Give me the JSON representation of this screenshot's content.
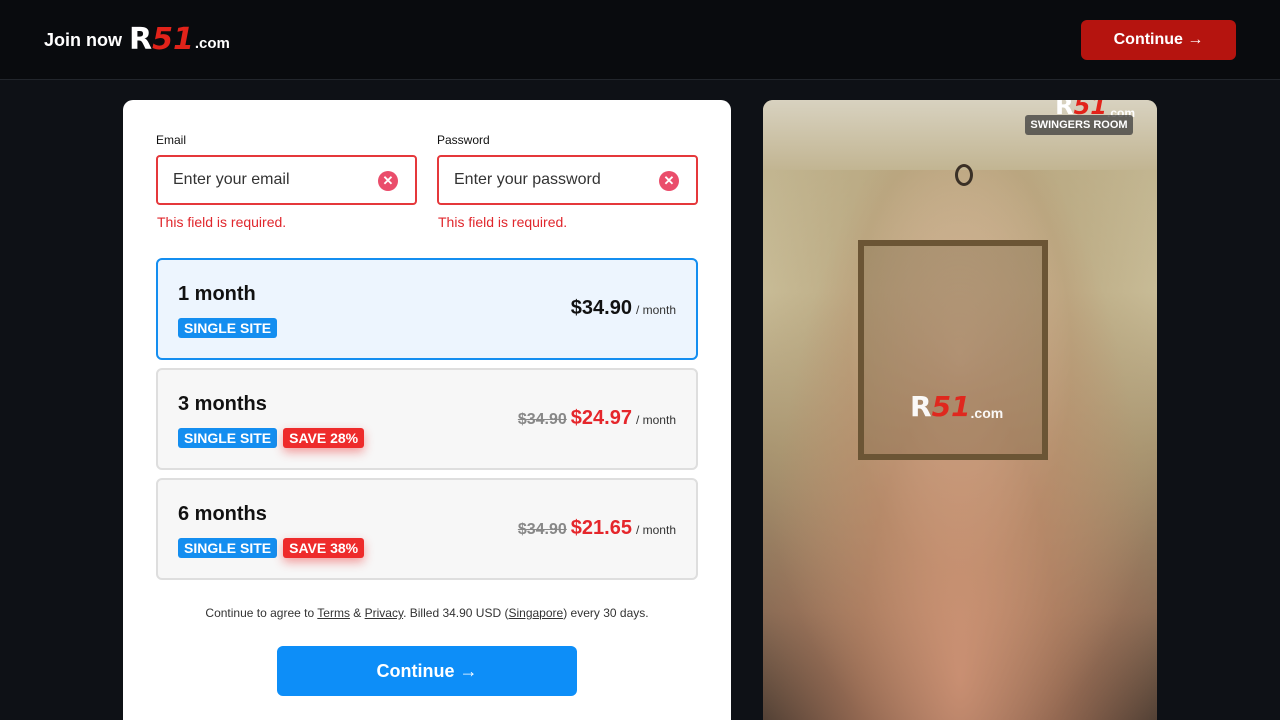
{
  "header": {
    "join_label": "Join now",
    "logo": {
      "r": "R",
      "num": "51",
      "dotcom": ".com"
    },
    "cta_label": "Continue →"
  },
  "form": {
    "email": {
      "label": "Email",
      "placeholder": "Enter your email",
      "value": "",
      "error": "This field is required."
    },
    "password": {
      "label": "Password",
      "placeholder": "Enter your password",
      "value": "",
      "error": "This field is required."
    }
  },
  "plans": [
    {
      "title": "1 month",
      "tags": [
        "SINGLE SITE"
      ],
      "old_price": "",
      "price": "$34.90",
      "per": "/ month",
      "selected": true
    },
    {
      "title": "3 months",
      "tags": [
        "SINGLE SITE",
        "SAVE 28%"
      ],
      "old_price": "$34.90",
      "price": "$24.97",
      "per": "/ month",
      "selected": false
    },
    {
      "title": "6 months",
      "tags": [
        "SINGLE SITE",
        "SAVE 38%"
      ],
      "old_price": "$34.90",
      "price": "$21.65",
      "per": "/ month",
      "selected": false
    }
  ],
  "fine_print": {
    "prefix": "Continue to agree to ",
    "terms": "Terms",
    "amp": " & ",
    "privacy": "Privacy",
    "middle": ". Billed 34.90 USD (",
    "country": "Singapore",
    "suffix": ") every 30 days."
  },
  "cta_label": "Continue →",
  "promo": {
    "room_badge": "SWINGERS ROOM",
    "watermark": {
      "r": "R",
      "num": "51",
      "dotcom": ".com"
    }
  },
  "colors": {
    "accent_blue": "#0d8ef8",
    "accent_red": "#b5140f",
    "error": "#e5383b"
  }
}
